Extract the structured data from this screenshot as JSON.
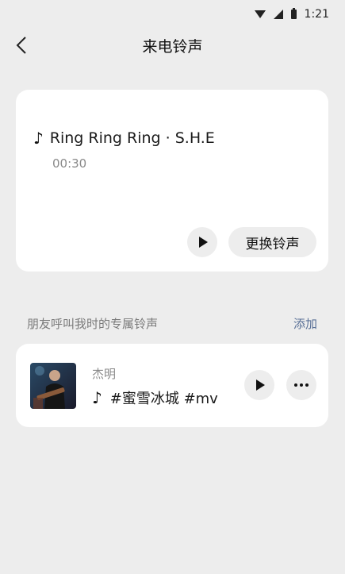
{
  "status_bar": {
    "time": "1:21",
    "icons": [
      "wifi-icon",
      "signal-icon",
      "battery-icon"
    ]
  },
  "header": {
    "title": "来电铃声",
    "back_icon": "chevron-left-icon"
  },
  "current_ringtone": {
    "note_icon": "♪",
    "title": "Ring Ring Ring · S.H.E",
    "duration": "00:30",
    "change_label": "更换铃声"
  },
  "friends_section": {
    "title": "朋友呼叫我时的专属铃声",
    "add_label": "添加",
    "items": [
      {
        "name": "杰明",
        "note_icon": "♪",
        "song": "#蜜雪冰城 #mv"
      }
    ]
  },
  "colors": {
    "background": "#ededed",
    "card": "#ffffff",
    "link": "#5a7197",
    "button_bg": "#ededed"
  }
}
